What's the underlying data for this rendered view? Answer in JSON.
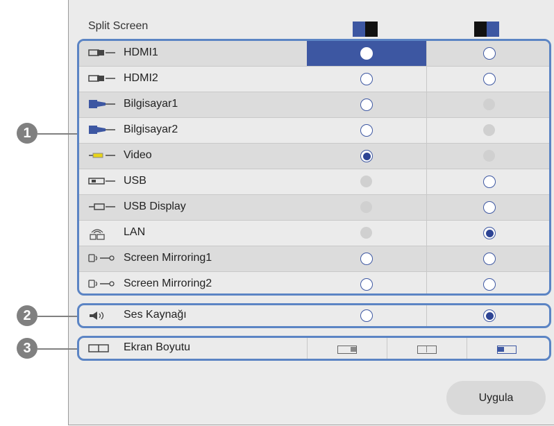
{
  "title": "Split Screen",
  "sources": [
    {
      "label": "HDMI1",
      "icon": "hdmi-icon",
      "left": "selected-on",
      "right": "off"
    },
    {
      "label": "HDMI2",
      "icon": "hdmi-icon",
      "left": "off",
      "right": "off"
    },
    {
      "label": "Bilgisayar1",
      "icon": "computer-icon",
      "left": "off",
      "right": "disabled"
    },
    {
      "label": "Bilgisayar2",
      "icon": "computer-icon",
      "left": "off",
      "right": "disabled"
    },
    {
      "label": "Video",
      "icon": "video-icon",
      "left": "on",
      "right": "disabled"
    },
    {
      "label": "USB",
      "icon": "usb-icon",
      "left": "disabled",
      "right": "off"
    },
    {
      "label": "USB Display",
      "icon": "usb-display-icon",
      "left": "disabled",
      "right": "off"
    },
    {
      "label": "LAN",
      "icon": "lan-icon",
      "left": "disabled",
      "right": "on"
    },
    {
      "label": "Screen Mirroring1",
      "icon": "screen-mirroring-icon",
      "left": "off",
      "right": "off"
    },
    {
      "label": "Screen Mirroring2",
      "icon": "screen-mirroring-icon",
      "left": "off",
      "right": "off"
    }
  ],
  "audio": {
    "label": "Ses Kaynağı",
    "icon": "speaker-icon",
    "left": "off",
    "right": "on"
  },
  "screen_size": {
    "label": "Ekran Boyutu",
    "icon": "screen-size-icon",
    "options": [
      "left-large",
      "equal",
      "right-large"
    ]
  },
  "callouts": [
    "1",
    "2",
    "3"
  ],
  "apply_label": "Uygula",
  "colors": {
    "accent": "#3d57a2",
    "group_border": "#5b84c4",
    "panel_bg": "#ebebeb"
  }
}
